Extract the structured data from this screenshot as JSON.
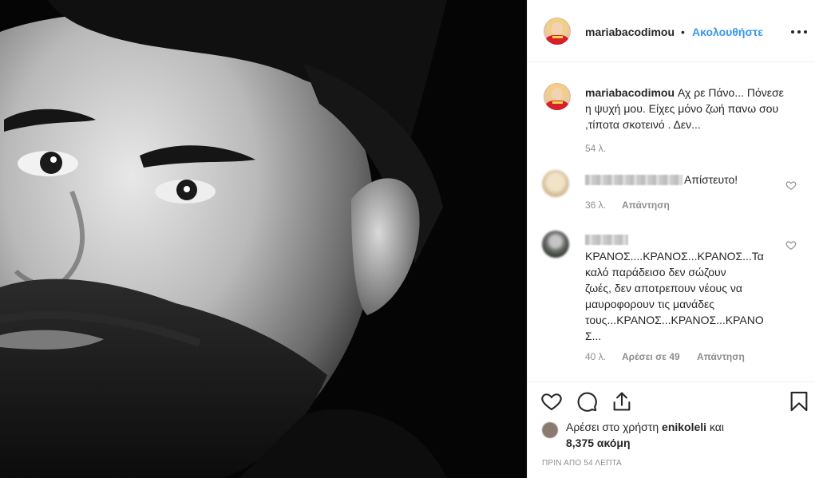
{
  "post": {
    "author": "mariabacodimou",
    "follow_label": "Ακολουθήστε",
    "separator": "•"
  },
  "caption": {
    "user": "mariabacodimou",
    "text": "Αχ ρε Πάνο... Πόνεσε η ψυχή μου. Είχες μόνο ζωή πανω σου ,τίποτα σκοτεινό . Δεν...",
    "time": "54 λ."
  },
  "comments": [
    {
      "text": "Απίστευτο!",
      "time": "36 λ.",
      "reply_label": "Απάντηση"
    },
    {
      "text": "ΚΡΑΝΟΣ....ΚΡΑΝΟΣ...ΚΡΑΝΟΣ...Τα καλό παράδεισο δεν σώζουν ζωές, δεν αποτρεπουν νέους να μαυροφορουν τις μανάδες τους...ΚΡΑΝΟΣ...ΚΡΑΝΟΣ...ΚΡΑΝΟΣ...",
      "line1": "ΚΡΑΝΟΣ....ΚΡΑΝΟΣ...ΚΡΑΝΟΣ...Τα",
      "line2": "καλό παράδεισο δεν σώζουν",
      "line3": "ζωές, δεν αποτρεπουν νέους να",
      "line4": "μαυροφορουν τις μανάδες",
      "line5": "τους...ΚΡΑΝΟΣ...ΚΡΑΝΟΣ...ΚΡΑΝΟ",
      "line6": "Σ...",
      "time": "40 λ.",
      "likes_label": "Αρέσει σε 49",
      "reply_label": "Απάντηση"
    }
  ],
  "likes": {
    "prefix": "Αρέσει στο χρήστη",
    "user": "enikoleli",
    "conjunction": "και",
    "count": "8,375 ακόμη"
  },
  "posted_time": "ΠΡΙΝ ΑΠΟ 54 ΛΕΠΤΑ",
  "icons": {
    "like": "heart-icon",
    "comment": "speech-bubble-icon",
    "share": "share-icon",
    "save": "bookmark-icon",
    "more": "ellipsis-icon",
    "comment_like": "heart-outline-icon"
  },
  "colors": {
    "link_blue": "#3897f0",
    "text": "#262626",
    "muted": "#8e8e8e"
  }
}
